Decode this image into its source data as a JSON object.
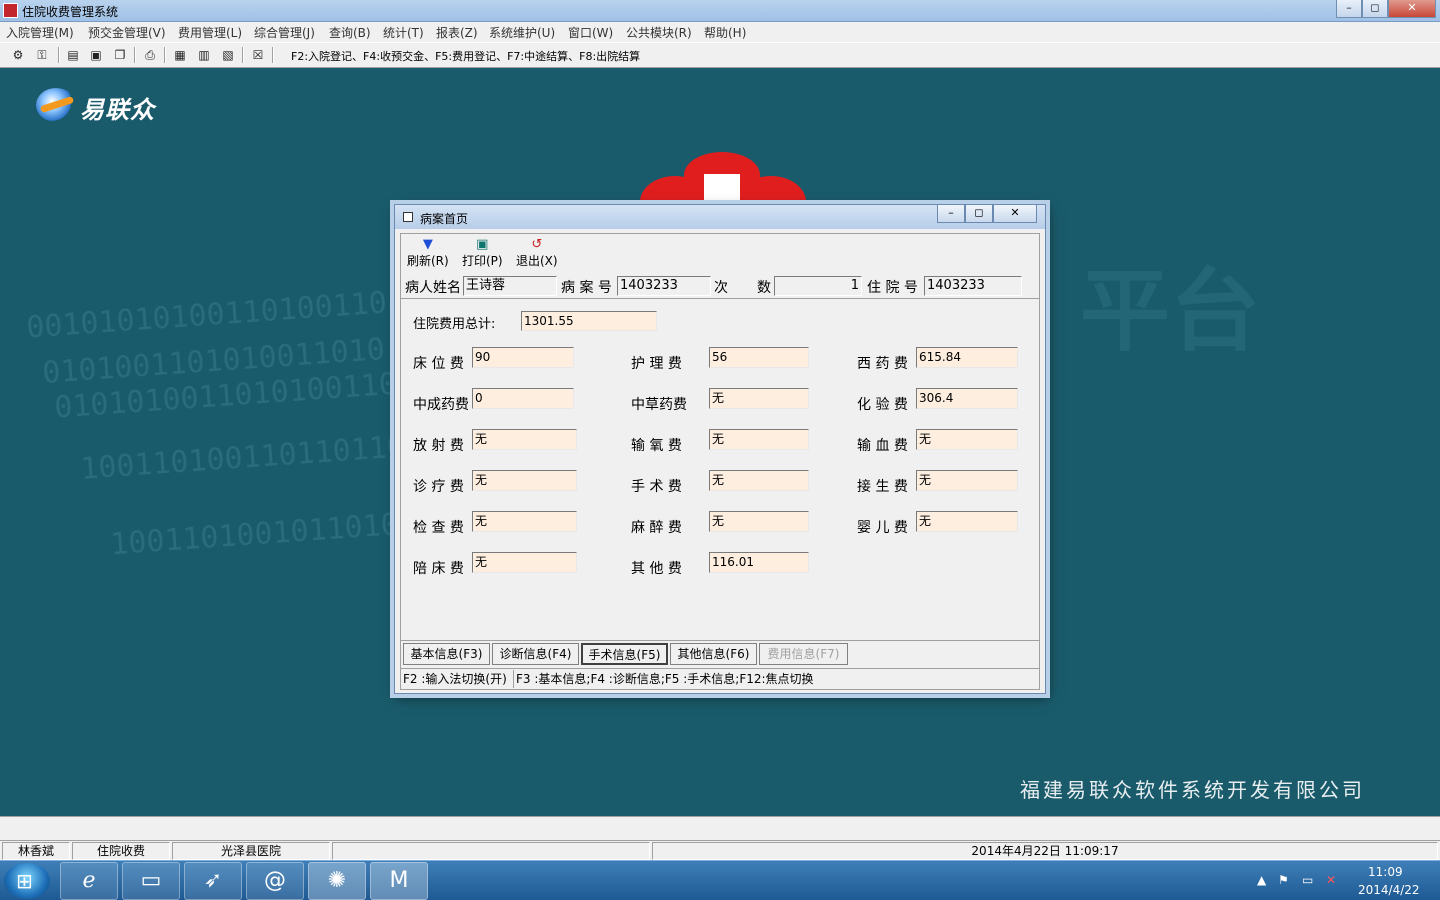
{
  "window": {
    "title": "住院收费管理系统",
    "controls": {
      "minimize": "–",
      "maximize": "◻",
      "close": "✕"
    }
  },
  "menu": [
    "入院管理(M)",
    "预交金管理(V)",
    "费用管理(L)",
    "综合管理(J)",
    "查询(B)",
    "统计(T)",
    "报表(Z)",
    "系统维护(U)",
    "窗口(W)",
    "公共模块(R)",
    "帮助(H)"
  ],
  "toolbar": {
    "shortcut_hint": "F2:入院登记、F4:收预交金、F5:费用登记、F7:中途结算、F8:出院结算",
    "icons": [
      "key-gear-icon",
      "key-icon",
      "document-icon",
      "register-icon",
      "copy-icon",
      "print-icon",
      "stamp-icon",
      "calculator-icon",
      "ledger-icon",
      "exit-icon"
    ]
  },
  "desktop": {
    "logo_text": "易联众",
    "binary_lines": [
      "00101010100110100110",
      "0101001101010011010",
      "01010100110101001101",
      "1001101001101101100",
      "100110100101101011"
    ],
    "watermark": "平台",
    "company": "福建易联众软件系统开发有限公司"
  },
  "dialog": {
    "title": "病案首页",
    "controls": {
      "minimize": "–",
      "maximize": "◻",
      "close": "✕"
    },
    "toolbar": [
      {
        "icon": "filter-icon",
        "label": "刷新(R)"
      },
      {
        "icon": "save-icon",
        "label": "打印(P)"
      },
      {
        "icon": "undo-icon",
        "label": "退出(X)"
      }
    ],
    "patient": {
      "name_label": "病人姓名",
      "name": "王诗蓉",
      "case_no_label": "病 案 号",
      "case_no": "1403233",
      "times_label_1": "次",
      "times_label_2": "数",
      "times": "1",
      "admission_no_label": "住 院 号",
      "admission_no": "1403233"
    },
    "total": {
      "label": "住院费用总计:",
      "value": "1301.55"
    },
    "fees": [
      {
        "label": "床 位 费",
        "value": "90"
      },
      {
        "label": "护 理 费",
        "value": "56"
      },
      {
        "label": "西 药 费",
        "value": "615.84"
      },
      {
        "label": "中成药费",
        "value": "0"
      },
      {
        "label": "中草药费",
        "value": "无"
      },
      {
        "label": "化 验 费",
        "value": "306.4"
      },
      {
        "label": "放 射 费",
        "value": "无"
      },
      {
        "label": "输 氧 费",
        "value": "无"
      },
      {
        "label": "输 血 费",
        "value": "无"
      },
      {
        "label": "诊 疗 费",
        "value": "无"
      },
      {
        "label": "手 术 费",
        "value": "无"
      },
      {
        "label": "接 生 费",
        "value": "无"
      },
      {
        "label": "检 查 费",
        "value": "无"
      },
      {
        "label": "麻 醉 费",
        "value": "无"
      },
      {
        "label": "婴 儿 费",
        "value": "无"
      },
      {
        "label": "陪 床 费",
        "value": "无"
      },
      {
        "label": "其 他 费",
        "value": "116.01"
      }
    ],
    "tabs": [
      "基本信息(F3)",
      "诊断信息(F4)",
      "手术信息(F5)",
      "其他信息(F6)",
      "费用信息(F7)"
    ],
    "status": [
      "F2 :输入法切换(开)",
      "F3 :基本信息;F4 :诊断信息;F5 :手术信息;F12:焦点切换"
    ]
  },
  "statusbar": {
    "user": "林香斌",
    "module": "住院收费",
    "hospital": "光泽县医院",
    "datetime": "2014年4月22日 11:09:17"
  },
  "taskbar": {
    "apps": [
      "ie-icon",
      "folder-icon",
      "bird-icon",
      "contacts-icon",
      "app-icon",
      "m-app-icon"
    ],
    "tray": [
      "▲",
      "flag-icon",
      "network-icon",
      "mute-icon"
    ],
    "time": "11:09",
    "date": "2014/4/22"
  },
  "colors": {
    "desktop": "#1a5b6b",
    "field_bg": "#fdeee0",
    "titlebar": "#b9d3ee"
  }
}
